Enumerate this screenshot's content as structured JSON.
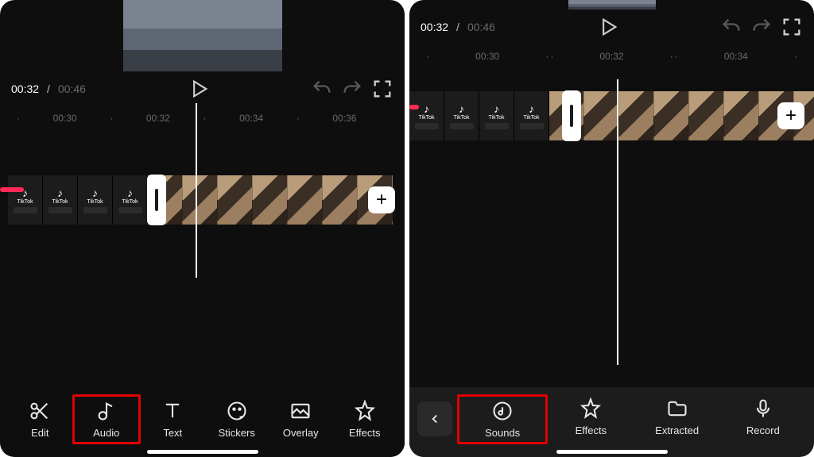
{
  "left": {
    "time_current": "00:32",
    "time_sep": " / ",
    "time_total": "00:46",
    "ruler": [
      "00:30",
      "00:32",
      "00:34",
      "00:36"
    ],
    "tiktok_label": "TikTok",
    "add_label": "+",
    "toolbar": [
      {
        "name": "edit-tool",
        "label": "Edit",
        "icon": "scissors",
        "hl": false
      },
      {
        "name": "audio-tool",
        "label": "Audio",
        "icon": "music-note",
        "hl": true
      },
      {
        "name": "text-tool",
        "label": "Text",
        "icon": "text",
        "hl": false
      },
      {
        "name": "stickers-tool",
        "label": "Stickers",
        "icon": "sticker",
        "hl": false
      },
      {
        "name": "overlay-tool",
        "label": "Overlay",
        "icon": "overlay",
        "hl": false
      },
      {
        "name": "effects-tool",
        "label": "Effects",
        "icon": "star",
        "hl": false
      }
    ]
  },
  "right": {
    "time_current": "00:32",
    "time_sep": " / ",
    "time_total": "00:46",
    "ruler": [
      "00:30",
      "00:32",
      "00:34"
    ],
    "tiktok_label": "TikTok",
    "add_label": "+",
    "toolbar": [
      {
        "name": "sounds-tool",
        "label": "Sounds",
        "icon": "sounds",
        "hl": true
      },
      {
        "name": "effects-tool",
        "label": "Effects",
        "icon": "star",
        "hl": false
      },
      {
        "name": "extracted-tool",
        "label": "Extracted",
        "icon": "folder",
        "hl": false
      },
      {
        "name": "record-tool",
        "label": "Record",
        "icon": "mic",
        "hl": false
      }
    ]
  }
}
